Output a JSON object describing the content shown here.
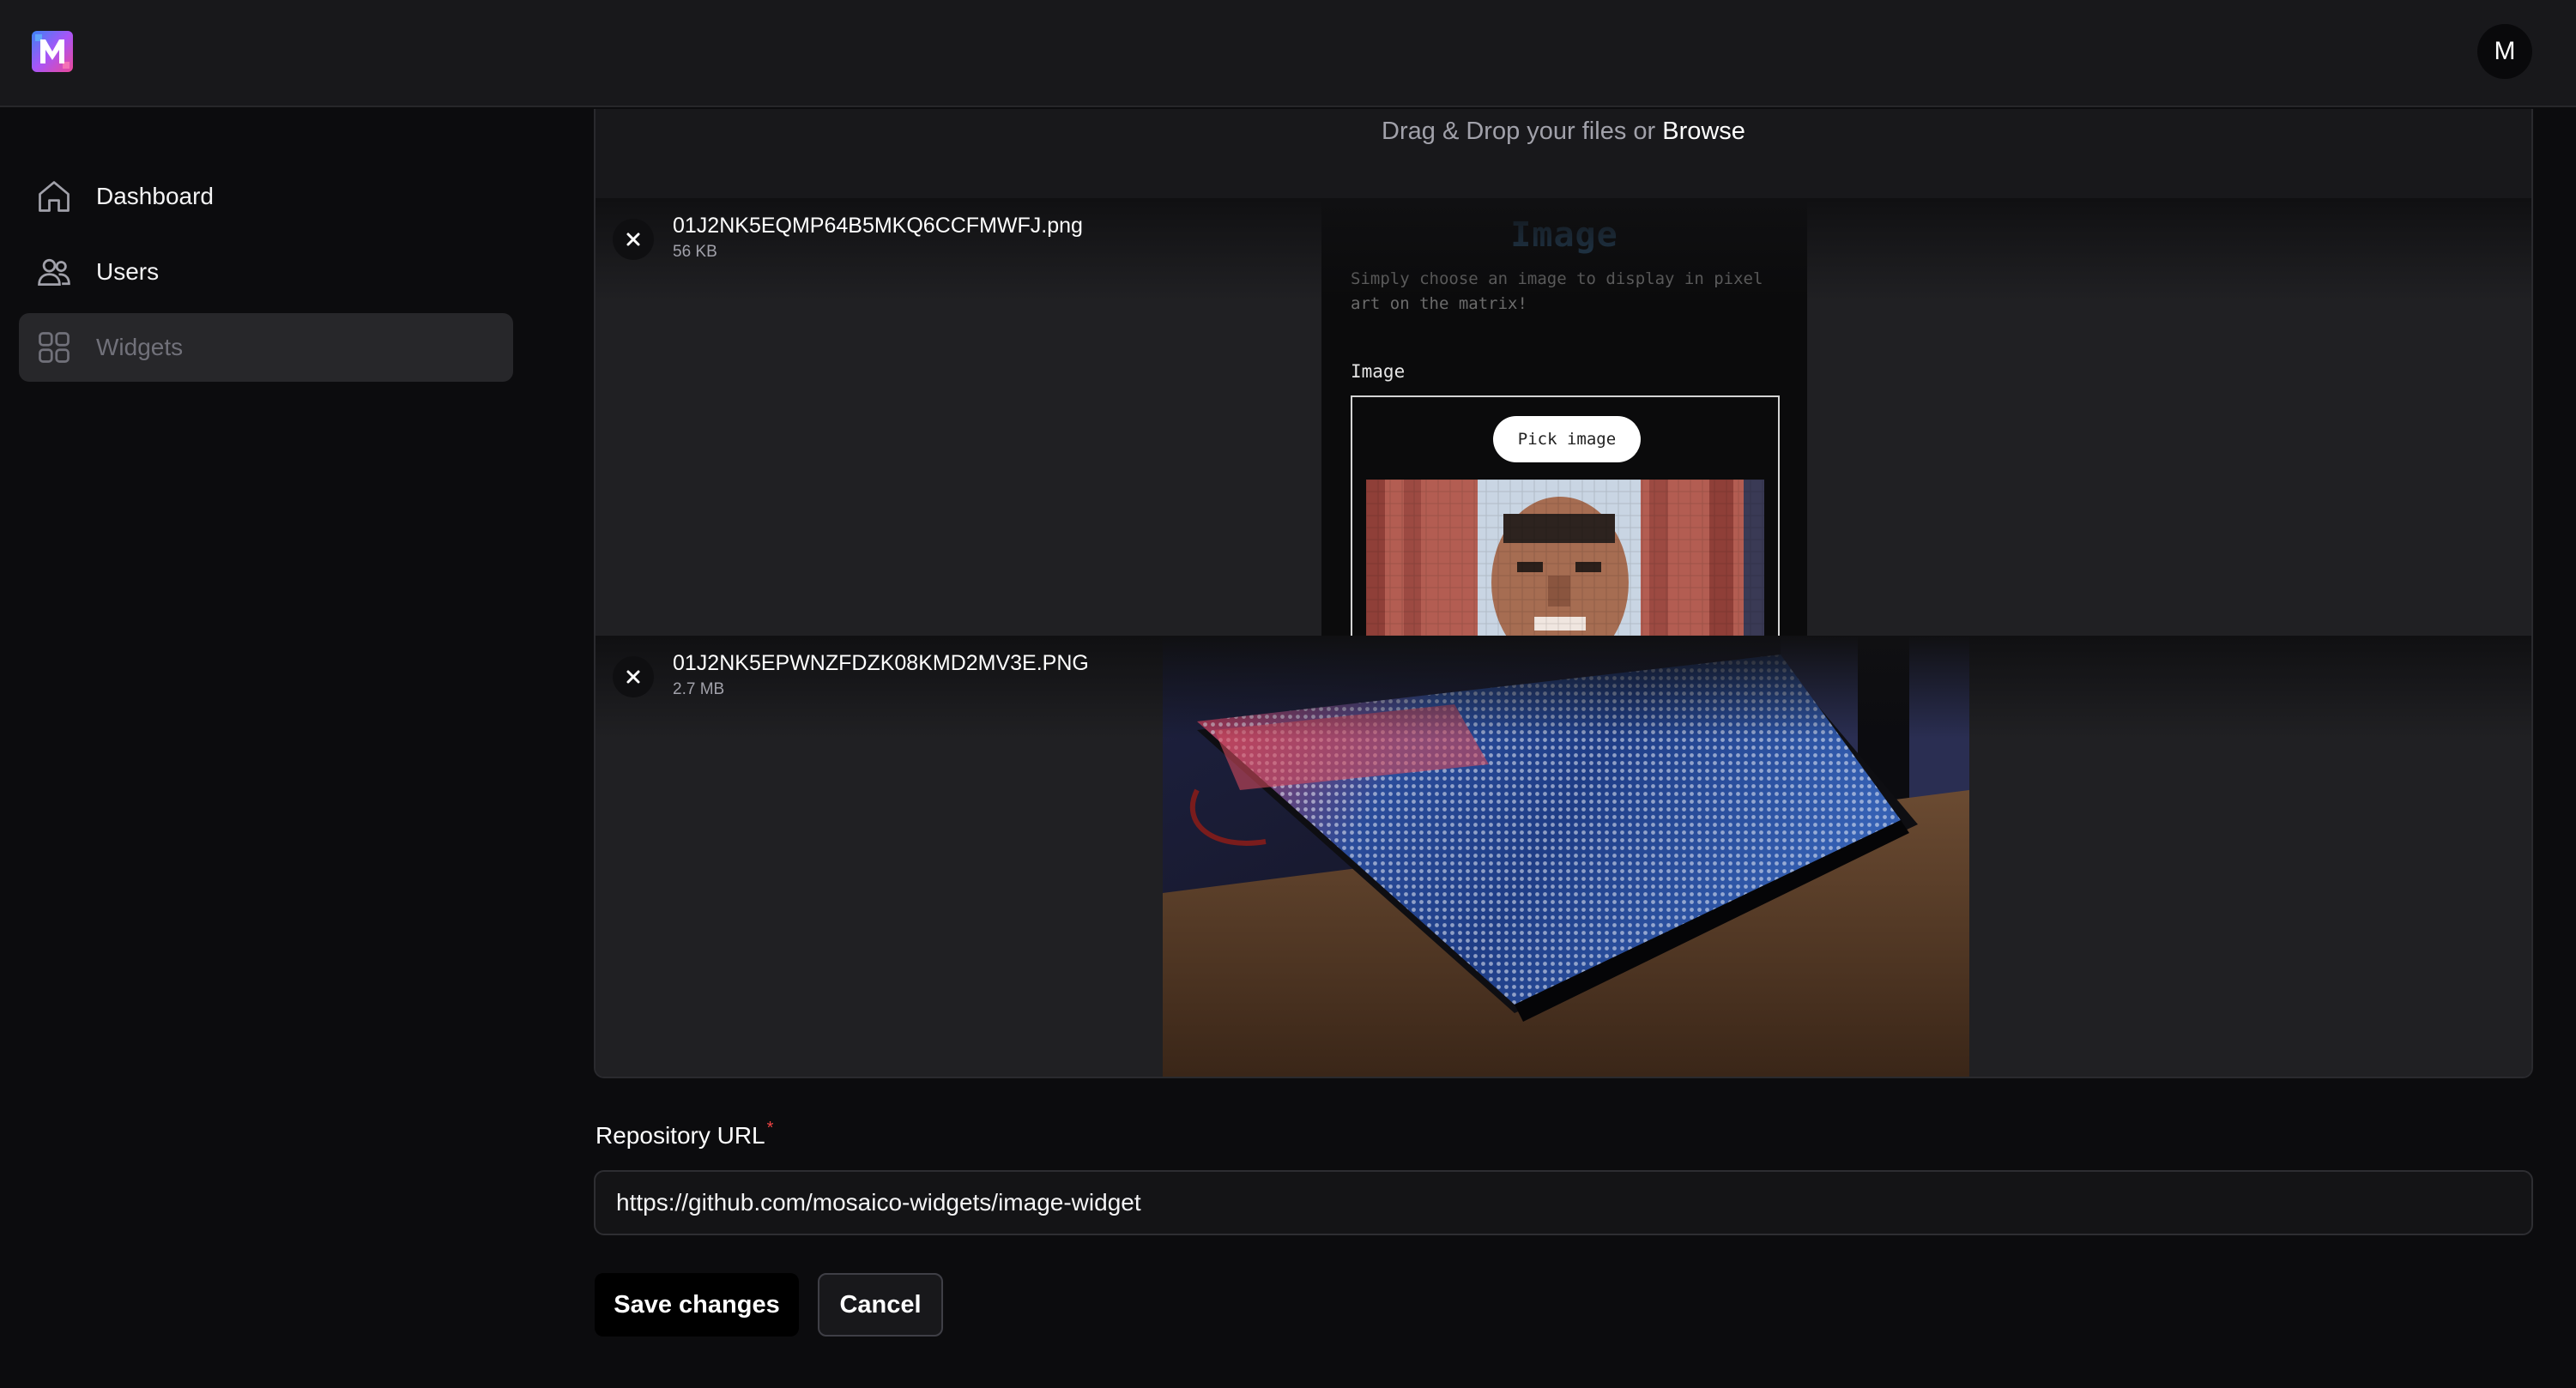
{
  "app": {
    "avatar_initial": "M"
  },
  "sidebar": {
    "items": [
      {
        "label": "Dashboard",
        "icon": "home-icon",
        "active": false
      },
      {
        "label": "Users",
        "icon": "users-icon",
        "active": false
      },
      {
        "label": "Widgets",
        "icon": "grid-icon",
        "active": true
      }
    ]
  },
  "upload": {
    "drop_text": "Drag & Drop your files or",
    "browse_label": "Browse",
    "files": [
      {
        "name": "01J2NK5EQMP64B5MKQ6CCFMWFJ.png",
        "size": "56 KB",
        "preview": {
          "title": "Image",
          "description": "Simply choose an image to display in pixel art on the matrix!",
          "field_label": "Image",
          "button_label": "Pick image"
        }
      },
      {
        "name": "01J2NK5EPWNZFDZK08KMD2MV3E.PNG",
        "size": "2.7 MB"
      }
    ]
  },
  "form": {
    "repo_label": "Repository URL",
    "required_mark": "*",
    "repo_value": "https://github.com/mosaico-widgets/image-widget",
    "save_label": "Save changes",
    "cancel_label": "Cancel"
  },
  "colors": {
    "background": "#0c0c0e",
    "topbar": "#18181b",
    "active_nav": "#27272a",
    "required": "#ef4444"
  }
}
